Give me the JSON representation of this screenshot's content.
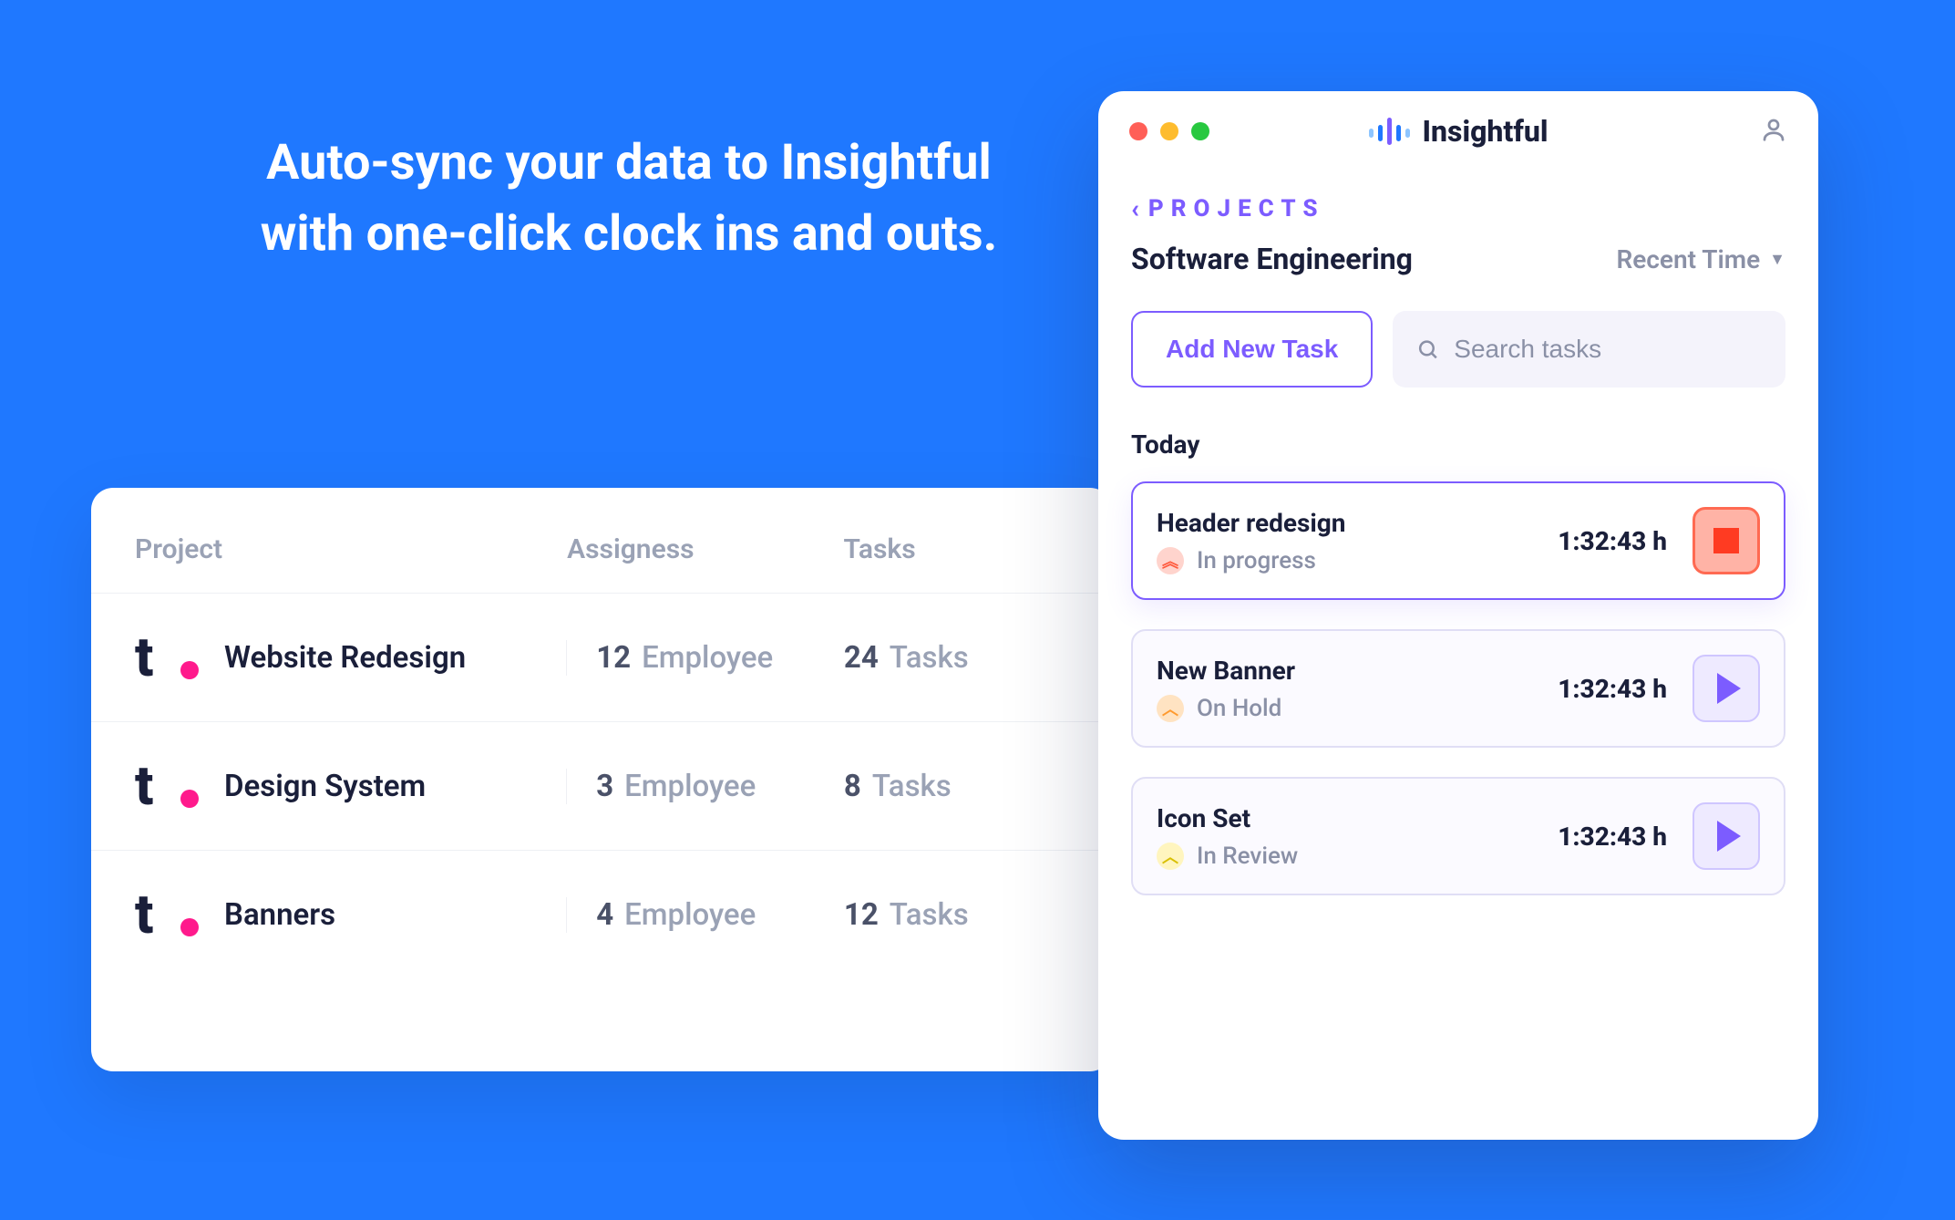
{
  "headline": "Auto-sync your data to Insightful with one-click clock ins and outs.",
  "projects_table": {
    "headers": {
      "project": "Project",
      "assignees": "Assigness",
      "tasks": "Tasks"
    },
    "employee_label": "Employee",
    "tasks_label": "Tasks",
    "rows": [
      {
        "name": "Website Redesign",
        "assignees": 12,
        "tasks": 24
      },
      {
        "name": "Design System",
        "assignees": 3,
        "tasks": 8
      },
      {
        "name": "Banners",
        "assignees": 4,
        "tasks": 12
      }
    ]
  },
  "app": {
    "brand_name": "Insightful",
    "breadcrumb_label": "PROJECTS",
    "subtitle": "Software Engineering",
    "sort_label": "Recent Time",
    "add_task_label": "Add New Task",
    "search_placeholder": "Search tasks",
    "section_label": "Today",
    "tasks": [
      {
        "title": "Header redesign",
        "status": "In progress",
        "status_icon": "double-chevron-up-icon",
        "status_color": "red",
        "time": "1:32:43 h",
        "action": "stop"
      },
      {
        "title": "New Banner",
        "status": "On Hold",
        "status_icon": "chevron-up-icon",
        "status_color": "orange",
        "time": "1:32:43 h",
        "action": "play"
      },
      {
        "title": "Icon Set",
        "status": "In Review",
        "status_icon": "chevron-up-icon",
        "status_color": "yellow",
        "time": "1:32:43 h",
        "action": "play"
      }
    ]
  }
}
